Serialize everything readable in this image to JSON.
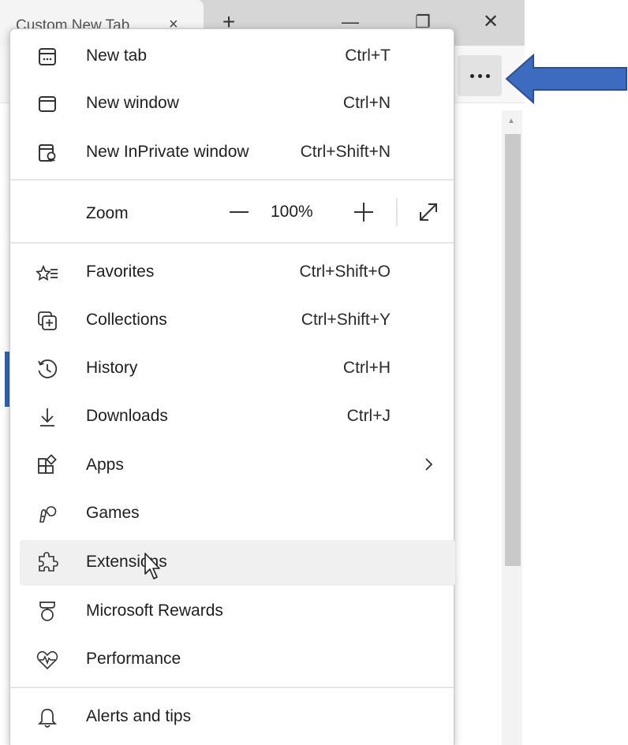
{
  "browser": {
    "tab_title": "Custom New Tab",
    "tab_close": "×",
    "new_tab_button": "+",
    "minimize": "—",
    "restore": "❐",
    "close": "✕",
    "more_button_icon": "ellipsis-icon"
  },
  "menu": {
    "items_top": [
      {
        "label": "New tab",
        "shortcut": "Ctrl+T",
        "icon": "new-tab-icon"
      },
      {
        "label": "New window",
        "shortcut": "Ctrl+N",
        "icon": "new-window-icon"
      },
      {
        "label": "New InPrivate window",
        "shortcut": "Ctrl+Shift+N",
        "icon": "inprivate-window-icon"
      }
    ],
    "zoom": {
      "label": "Zoom",
      "value": "100%",
      "minus_icon": "zoom-out-icon",
      "plus_icon": "zoom-in-icon",
      "fullscreen_icon": "fullscreen-icon"
    },
    "items_main": [
      {
        "label": "Favorites",
        "shortcut": "Ctrl+Shift+O",
        "icon": "favorites-icon"
      },
      {
        "label": "Collections",
        "shortcut": "Ctrl+Shift+Y",
        "icon": "collections-icon"
      },
      {
        "label": "History",
        "shortcut": "Ctrl+H",
        "icon": "history-icon"
      },
      {
        "label": "Downloads",
        "shortcut": "Ctrl+J",
        "icon": "downloads-icon"
      },
      {
        "label": "Apps",
        "shortcut": "",
        "icon": "apps-icon",
        "submenu": true
      },
      {
        "label": "Games",
        "shortcut": "",
        "icon": "games-icon"
      },
      {
        "label": "Extensions",
        "shortcut": "",
        "icon": "extensions-icon",
        "hovered": true
      },
      {
        "label": "Microsoft Rewards",
        "shortcut": "",
        "icon": "rewards-icon"
      },
      {
        "label": "Performance",
        "shortcut": "",
        "icon": "performance-icon"
      }
    ],
    "items_bottom": [
      {
        "label": "Alerts and tips",
        "shortcut": "",
        "icon": "bell-icon"
      }
    ]
  },
  "annotation": {
    "arrow_color": "#3d6bbf",
    "arrow_border_color": "#2d4f8e"
  },
  "colors": {
    "hover_bg": "#f0f0f0",
    "accent": "#2f67b8"
  }
}
